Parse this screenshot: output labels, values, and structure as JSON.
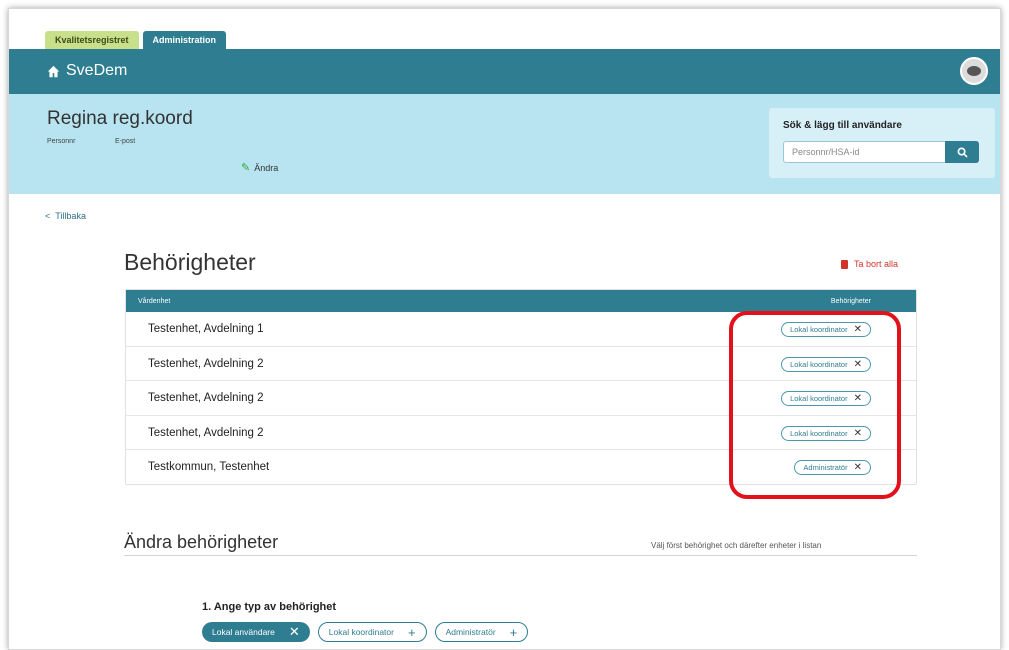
{
  "tabs": [
    {
      "label": "Kvalitetsregistret"
    },
    {
      "label": "Administration"
    }
  ],
  "header": {
    "brand": "SveDem"
  },
  "user": {
    "name": "Regina reg.koord",
    "personnr_label": "Personnr",
    "email_label": "E-post",
    "edit_label": "Ändra"
  },
  "search": {
    "title": "Sök & lägg till användare",
    "placeholder": "Personnr/HSA-id"
  },
  "back_label": "Tillbaka",
  "permissions": {
    "title": "Behörigheter",
    "remove_all_label": "Ta bort alla",
    "columns": [
      "Vårdenhet",
      "Behörigheter"
    ],
    "rows": [
      {
        "unit": "Testenhet, Avdelning 1",
        "role": "Lokal koordinator"
      },
      {
        "unit": "Testenhet, Avdelning 2",
        "role": "Lokal koordinator"
      },
      {
        "unit": "Testenhet, Avdelning 2",
        "role": "Lokal koordinator"
      },
      {
        "unit": "Testenhet, Avdelning 2",
        "role": "Lokal koordinator"
      },
      {
        "unit": "Testkommun, Testenhet",
        "role": "Administratör"
      }
    ]
  },
  "change": {
    "title": "Ändra behörigheter",
    "hint": "Välj först behörighet och därefter enheter i listan",
    "step1_label": "1. Ange typ av behörighet",
    "options": [
      {
        "label": "Lokal användare",
        "state": "selected"
      },
      {
        "label": "Lokal koordinator",
        "state": "add"
      },
      {
        "label": "Administratör",
        "state": "add"
      }
    ]
  },
  "colors": {
    "primary": "#2e7d91",
    "userbar": "#b7e4f0",
    "tab_green": "#c9e08a",
    "danger": "#d0342c",
    "highlight": "#e3111b"
  }
}
